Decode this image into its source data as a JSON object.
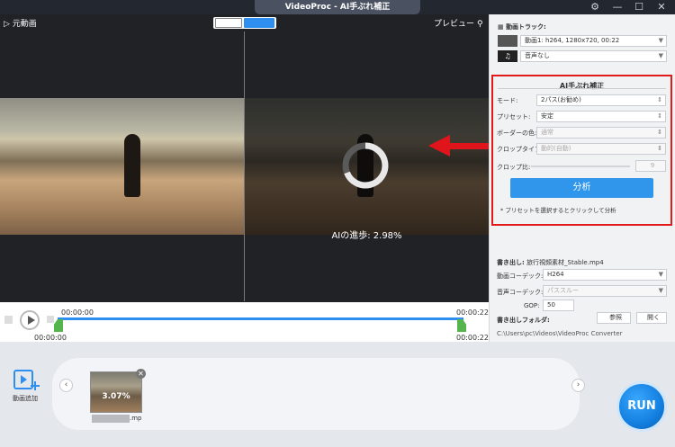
{
  "window": {
    "title": "VideoProc - AI手ぶれ補正",
    "gear_icon": "gear-icon",
    "minimize": "—",
    "maximize": "☐",
    "close": "✕"
  },
  "preview": {
    "original_label": "▷ 元動画",
    "preview_label": "プレビュー",
    "ai_progress": "AIの進歩: 2.98%",
    "time_start_top": "00:00:00",
    "time_end_top": "00:00:22",
    "time_start_bottom": "00:00:00",
    "time_end_bottom": "00:00:22"
  },
  "tracks": {
    "heading": "動画トラック:",
    "video_track": "動画1: h264, 1280x720, 00:22",
    "audio_track": "音声なし"
  },
  "stabilize": {
    "heading": "AI手ぶれ補正",
    "mode_label": "モード:",
    "mode_value": "2パス(お勧め)",
    "preset_label": "プリセット:",
    "preset_value": "安定",
    "border_label": "ボーダーの色:",
    "border_value": "通常",
    "crop_label": "クロップタイプ:",
    "crop_value": "動的(自動)",
    "ratio_label": "クロップ比:",
    "ratio_value": "9",
    "analyze_button": "分析",
    "hint": "* プリセットを選択するとクリックして分析"
  },
  "export": {
    "output_label": "書き出し:",
    "output_filename": "旅行視頻素材_Stable.mp4",
    "video_codec_label": "動画コーデック:",
    "video_codec_value": "H264",
    "audio_codec_label": "音声コーデック:",
    "audio_codec_value": "パススルー",
    "gop_label": "GOP:",
    "gop_value": "50",
    "folder_label": "書き出しフォルダ:",
    "browse_button": "参照",
    "open_button": "開く",
    "folder_path": "C:\\Users\\pc\\Videos\\VideoProc Converter"
  },
  "bottom": {
    "add_video_label": "動画追加",
    "thumb_progress": "3.07%",
    "thumb_filename": ".mp",
    "run_button": "RUN"
  },
  "colors": {
    "accent": "#2f8ff0",
    "highlight": "#e31a1a",
    "handle": "#54b54c"
  }
}
